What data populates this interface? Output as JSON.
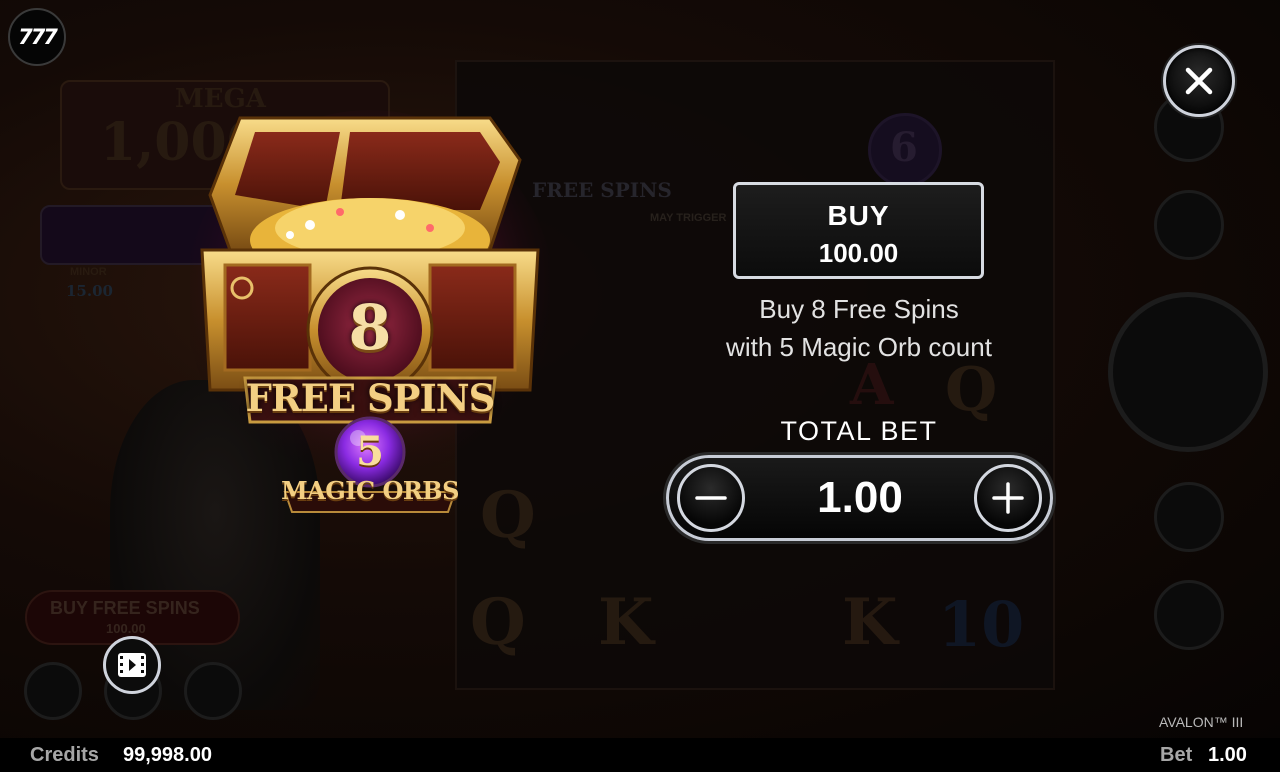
{
  "logo": {
    "text": "777"
  },
  "offer": {
    "free_spins_count": "8",
    "free_spins_label": "FREE SPINS",
    "magic_orbs_count": "5",
    "magic_orbs_label": "MAGIC ORBS"
  },
  "buy": {
    "label": "BUY",
    "price": "100.00",
    "description_line1": "Buy 8 Free Spins",
    "description_line2": "with 5 Magic Orb count"
  },
  "total_bet": {
    "label": "TOTAL BET",
    "value": "1.00"
  },
  "background": {
    "jackpot_mega_label": "MEGA",
    "jackpot_mega_value": "1,000",
    "jackpot_minor_label": "MINOR",
    "jackpot_minor_value": "15.00",
    "reel_free_spins": "FREE SPINS",
    "may_trigger": "MAY TRIGGER",
    "buy_free_spins_label": "BUY FREE SPINS",
    "buy_free_spins_price": "100.00",
    "orb_number": "6"
  },
  "footer": {
    "game_title": "AVALON™ III",
    "credits_label": "Credits",
    "credits_value": "99,998.00",
    "bet_label": "Bet",
    "bet_value": "1.00"
  },
  "colors": {
    "gold_text": "#f3cf83",
    "button_border": "#d7dbe2",
    "orb_purple": "#8a2be2"
  },
  "icons": [
    "close-icon",
    "minus-icon",
    "plus-icon",
    "video-icon"
  ]
}
